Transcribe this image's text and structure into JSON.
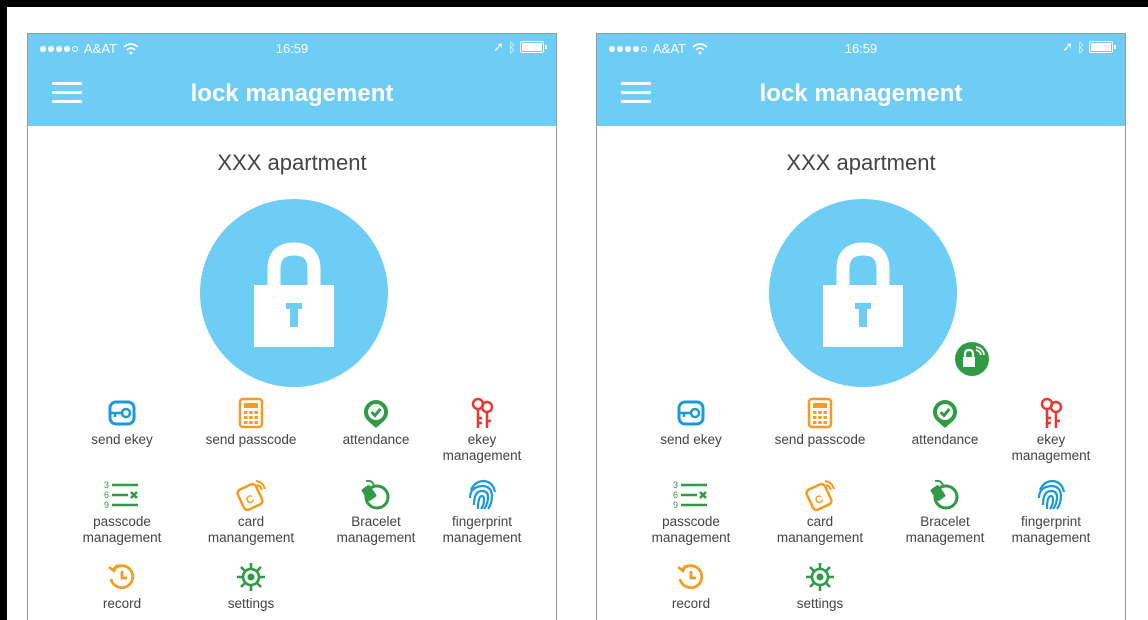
{
  "screens": [
    {
      "status": {
        "carrier": "A&AT",
        "time": "16:59"
      },
      "header": {
        "title": "lock management"
      },
      "apartment": "XXX apartment",
      "show_badge": false,
      "items": {
        "send_ekey": "send ekey",
        "send_passcode": "send passcode",
        "attendance": "attendance",
        "ekey_management": [
          "ekey",
          "management"
        ],
        "passcode_management": [
          "passcode",
          "management"
        ],
        "card_management": [
          "card",
          "manangement"
        ],
        "bracelet_management": [
          "Bracelet",
          "management"
        ],
        "fingerprint_management": [
          "fingerprint",
          "management"
        ],
        "record": "record",
        "settings": "settings"
      }
    },
    {
      "status": {
        "carrier": "A&AT",
        "time": "16:59"
      },
      "header": {
        "title": "lock management"
      },
      "apartment": "XXX apartment",
      "show_badge": true,
      "items": {
        "send_ekey": "send ekey",
        "send_passcode": "send passcode",
        "attendance": "attendance",
        "ekey_management": [
          "ekey",
          "management"
        ],
        "passcode_management": [
          "passcode",
          "management"
        ],
        "card_management": [
          "card",
          "manangement"
        ],
        "bracelet_management": [
          "Bracelet",
          "management"
        ],
        "fingerprint_management": [
          "fingerprint",
          "management"
        ],
        "record": "record",
        "settings": "settings"
      }
    }
  ],
  "colors": {
    "header": "#6dcdf4",
    "badge": "#2f9b44",
    "ekey": "#1a9ad8",
    "passcode": "#f39c1f",
    "attendance": "#2f9b44",
    "ekey_mgmt": "#e53935",
    "fingerprint": "#1a9ad8"
  }
}
